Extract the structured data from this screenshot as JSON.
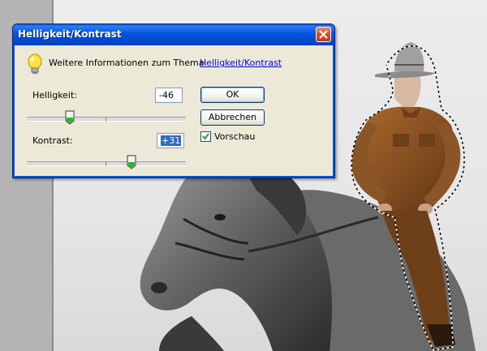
{
  "dialog": {
    "title": "Helligkeit/Kontrast",
    "info_text": "Weitere Informationen zum Thema",
    "info_link": "Helligkeit/Kontrast",
    "brightness": {
      "label": "Helligkeit:",
      "value": "-46",
      "slider_fraction": 0.27
    },
    "contrast": {
      "label": "Kontrast:",
      "value": "+31",
      "slider_fraction": 0.65
    },
    "ok_label": "OK",
    "cancel_label": "Abbrechen",
    "preview_label": "Vorschau",
    "preview_checked": true
  },
  "colors": {
    "title_bar": "#0a58e0",
    "dialog_bg": "#ece9d8",
    "selection_fill": "#8a5628",
    "link": "#0000ee"
  },
  "icons": [
    "lightbulb-icon",
    "close-icon",
    "checkmark-icon"
  ]
}
